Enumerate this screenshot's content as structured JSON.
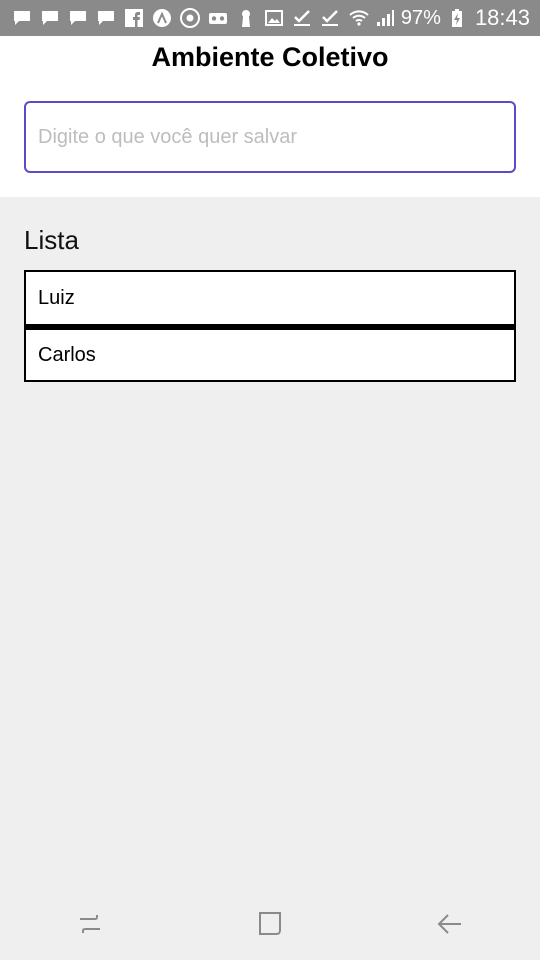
{
  "status_bar": {
    "battery_percent": "97%",
    "time": "18:43",
    "icons": [
      "message-icon",
      "message-icon",
      "message-icon",
      "message-icon",
      "facebook-icon",
      "app-icon",
      "chrome-icon",
      "voicemail-icon",
      "keyhole-icon",
      "image-icon",
      "download-done-icon",
      "download-done-icon",
      "wifi-icon",
      "signal-icon",
      "battery-charging-icon"
    ]
  },
  "header": {
    "title": "Ambiente Coletivo",
    "input_placeholder": "Digite o que você quer salvar",
    "input_value": ""
  },
  "list": {
    "title": "Lista",
    "items": [
      "Luiz",
      "Carlos"
    ]
  },
  "nav_bar": {
    "buttons": [
      "recent-apps-icon",
      "home-icon",
      "back-icon"
    ]
  },
  "colors": {
    "status_bar_bg": "#8a8a8a",
    "input_border": "#5a4bc7",
    "content_bg": "#efefef"
  }
}
